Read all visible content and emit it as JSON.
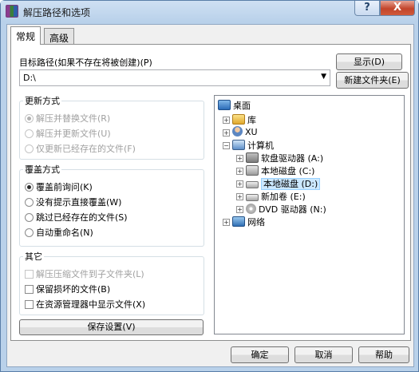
{
  "window": {
    "title": "解压路径和选项",
    "help_btn": "?",
    "close_btn": "X"
  },
  "tabs": [
    {
      "label": "常规",
      "active": true
    },
    {
      "label": "高级",
      "active": false
    }
  ],
  "path": {
    "label": "目标路径(如果不存在将被创建)(P)",
    "value": "D:\\",
    "show_btn": "显示(D)",
    "new_folder_btn": "新建文件夹(E)"
  },
  "update_mode": {
    "title": "更新方式",
    "options": [
      {
        "label": "解压并替换文件(R)",
        "checked": true,
        "disabled": true
      },
      {
        "label": "解压并更新文件(U)",
        "checked": false,
        "disabled": true
      },
      {
        "label": "仅更新已经存在的文件(F)",
        "checked": false,
        "disabled": true
      }
    ]
  },
  "overwrite_mode": {
    "title": "覆盖方式",
    "options": [
      {
        "label": "覆盖前询问(K)",
        "checked": true
      },
      {
        "label": "没有提示直接覆盖(W)",
        "checked": false
      },
      {
        "label": "跳过已经存在的文件(S)",
        "checked": false
      },
      {
        "label": "自动重命名(N)",
        "checked": false
      }
    ]
  },
  "other": {
    "title": "其它",
    "options": [
      {
        "label": "解压压缩文件到子文件夹(L)",
        "checked": false,
        "disabled": true
      },
      {
        "label": "保留损坏的文件(B)",
        "checked": false,
        "disabled": false
      },
      {
        "label": "在资源管理器中显示文件(X)",
        "checked": false,
        "disabled": false
      }
    ]
  },
  "save_btn": "保存设置(V)",
  "tree": {
    "nodes": [
      {
        "label": "桌面",
        "icon": "desktop-icon"
      },
      {
        "label": "库",
        "icon": "library-icon"
      },
      {
        "label": "XU",
        "icon": "user-icon"
      },
      {
        "label": "计算机",
        "icon": "computer-icon"
      },
      {
        "label": "软盘驱动器 (A:)",
        "icon": "floppy-drive-icon"
      },
      {
        "label": "本地磁盘 (C:)",
        "icon": "system-drive-icon"
      },
      {
        "label": "本地磁盘 (D:)",
        "icon": "hard-drive-icon",
        "selected": true
      },
      {
        "label": "新加卷 (E:)",
        "icon": "hard-drive-icon"
      },
      {
        "label": "DVD 驱动器 (N:)",
        "icon": "dvd-drive-icon"
      },
      {
        "label": "网络",
        "icon": "network-icon"
      }
    ]
  },
  "footer": {
    "ok": "确定",
    "cancel": "取消",
    "help": "帮助"
  },
  "colors": {
    "selection": "#cce8ff",
    "window_frame": "#b9d1ea",
    "close_button": "#c2452b"
  }
}
